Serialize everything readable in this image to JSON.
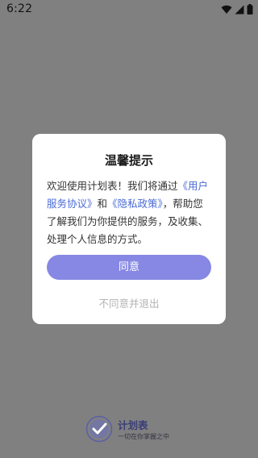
{
  "status_bar": {
    "time": "6:22"
  },
  "dialog": {
    "title": "温馨提示",
    "body": {
      "text_before": "欢迎使用计划表！我们将通过",
      "link_user_agreement": "《用户服务协议》",
      "text_and": "和",
      "link_privacy_policy": "《隐私政策》",
      "text_after": "，帮助您了解我们为你提供的服务，及收集、处理个人信息的方式。"
    },
    "agree_label": "同意",
    "disagree_label": "不同意并退出"
  },
  "footer": {
    "app_name": "计划表",
    "slogan": "一切在你掌握之中"
  },
  "colors": {
    "overlay_background": "#808080",
    "link": "#4a6bd6",
    "agree_button": "#8788e3",
    "disagree_text": "#b3b3b3",
    "brand": "#3a3d78"
  },
  "icons": {
    "signal": "signal-icon",
    "wifi": "wifi-icon",
    "battery": "battery-icon",
    "logo": "app-logo-icon"
  }
}
